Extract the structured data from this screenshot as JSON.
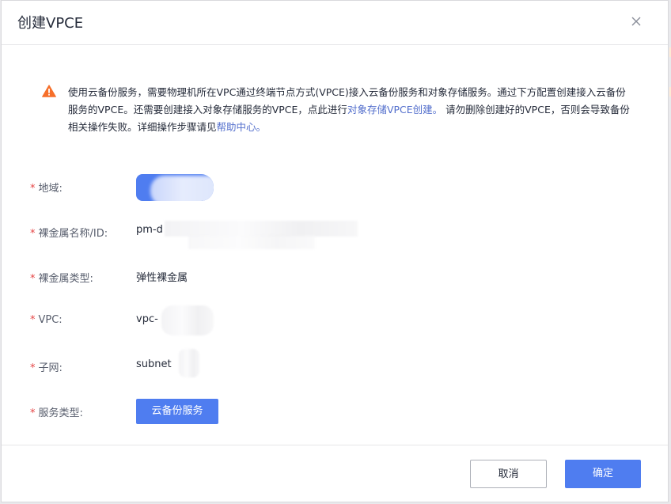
{
  "dialog": {
    "title": "创建VPCE",
    "close_icon": "close-icon"
  },
  "notice": {
    "icon": "warning-icon",
    "icon_color": "#f66f2a",
    "text_part1": "使用云备份服务，需要物理机所在VPC通过终端节点方式(VPCE)接入云备份服务和对象存储服务。通过下方配置创建接入云备份服务的VPCE。还需要创建接入对象存储服务的VPCE，点此进行",
    "link1": "对象存储VPCE创建。",
    "text_part2": " 请勿删除创建好的VPCE，否则会导致备份相关操作失败。详细操作步骤请见",
    "link2": "帮助中心。"
  },
  "form": {
    "required_mark": "*",
    "region": {
      "label": "地域:"
    },
    "bms_name": {
      "label": "裸金属名称/ID:",
      "value": "pm-d"
    },
    "bms_type": {
      "label": "裸金属类型:",
      "value": "弹性裸金属"
    },
    "vpc": {
      "label": "VPC:",
      "value": "vpc-"
    },
    "subnet": {
      "label": "子网:",
      "value": "subnet"
    },
    "service_type": {
      "label": "服务类型:",
      "value": "云备份服务"
    }
  },
  "footer": {
    "cancel_label": "取消",
    "confirm_label": "确定"
  },
  "colors": {
    "primary": "#4f7df0",
    "required": "#e54545",
    "link": "#526ecc"
  }
}
